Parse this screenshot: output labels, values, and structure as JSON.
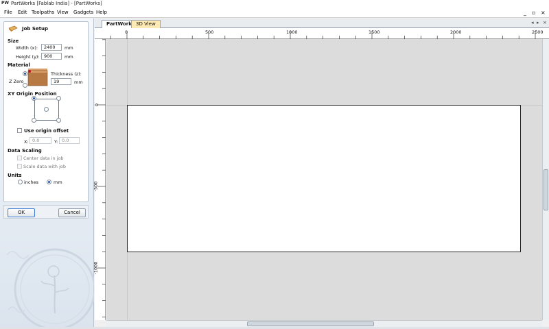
{
  "window": {
    "app_logo": "PW",
    "title": "PartWorks [Fablab India] - [PartWorks]"
  },
  "menu": {
    "items": [
      "File",
      "Edit",
      "Toolpaths",
      "View",
      "Gadgets",
      "Help"
    ],
    "mdi_controls": [
      "_",
      "▫",
      "×"
    ]
  },
  "job_setup": {
    "title": "Job Setup",
    "size": {
      "header": "Size",
      "width_label": "Width (x):",
      "width_value": "2400",
      "width_unit": "mm",
      "height_label": "Height (y):",
      "height_value": "900",
      "height_unit": "mm"
    },
    "material": {
      "header": "Material",
      "z_zero_label": "Z Zero",
      "thickness_label": "Thickness (z):",
      "thickness_value": "19",
      "thickness_unit": "mm"
    },
    "xy_origin": {
      "header": "XY Origin Position",
      "use_offset_label": "Use origin offset",
      "x_label": "X:",
      "x_value": "0.0",
      "y_label": "Y:",
      "y_value": "0.0"
    },
    "data_scaling": {
      "header": "Data Scaling",
      "center_label": "Center data in job",
      "scale_label": "Scale data with job"
    },
    "units": {
      "header": "Units",
      "inches_label": "inches",
      "mm_label": "mm",
      "selected": "mm"
    },
    "buttons": {
      "ok": "OK",
      "cancel": "Cancel"
    }
  },
  "view_tabs": {
    "tabs": [
      "PartWorks",
      "3D View"
    ],
    "active": "PartWorks",
    "controls": [
      "◂",
      "▸",
      "×"
    ]
  },
  "rulers": {
    "top_labels": [
      "0",
      "500",
      "1000",
      "1500",
      "2000",
      "2500"
    ],
    "left_labels": [
      "0",
      "-500",
      "-1000"
    ]
  },
  "colors": {
    "canvas_bg": "#dcdcdc",
    "workpiece": "#ffffff",
    "active_tab": "#ffffff",
    "inactive_tab": "#fde9b3"
  }
}
